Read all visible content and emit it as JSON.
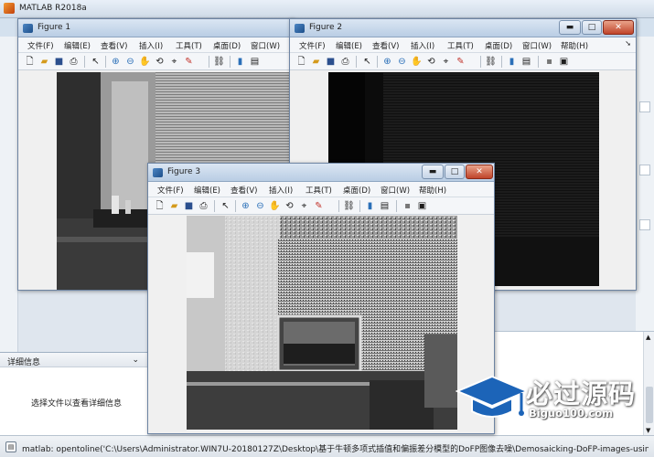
{
  "main_window": {
    "title": "MATLAB R2018a"
  },
  "details_panel": {
    "header": "详细信息",
    "message": "选择文件以查看详细信息"
  },
  "status_bar": {
    "text": "matlab: opentoline('C:\\Users\\Administrator.WIN7U-20180127Z\\Desktop\\基于牛顿多项式插值和偏振差分模型的DoFP图像去噪\\Demosaicking-DoFP-images-usin..."
  },
  "menu_labels": {
    "file": "文件(F)",
    "edit": "编辑(E)",
    "view": "查看(V)",
    "insert": "插入(I)",
    "tools": "工具(T)",
    "desktop": "桌面(D)",
    "window": "窗口(W)",
    "help": "帮助(H)"
  },
  "figures": [
    {
      "title": "Figure 1",
      "image": "grayscale photo of lab room with window blinds"
    },
    {
      "title": "Figure 2",
      "image": "dark grayscale image"
    },
    {
      "title": "Figure 3",
      "image": "noisy grayscale demosaicking result showing monitor and blinds"
    }
  ],
  "window_buttons": {
    "minimize": "▬",
    "maximize": "□",
    "close": "✕"
  },
  "watermark": {
    "chinese": "必过源码",
    "url": "Biguo100.com"
  },
  "icons": {
    "toolbar": [
      "new-file-icon",
      "open-file-icon",
      "save-icon",
      "print-icon",
      "pointer-icon",
      "zoom-in-icon",
      "zoom-out-icon",
      "pan-icon",
      "rotate-icon",
      "data-cursor-icon",
      "brush-icon",
      "link-icon",
      "colorbar-icon",
      "legend-icon",
      "hide-tools-icon",
      "dock-icon"
    ]
  }
}
